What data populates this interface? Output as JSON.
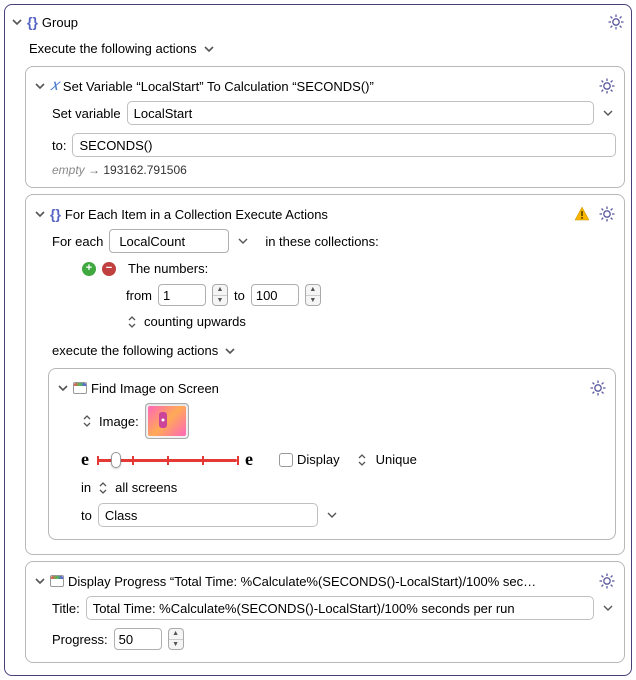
{
  "group": {
    "title": "Group",
    "subtitle": "Execute the following actions"
  },
  "setvar": {
    "title": "Set Variable “LocalStart” To Calculation “SECONDS()”",
    "label_set": "Set variable",
    "var_name": "LocalStart",
    "label_to": "to:",
    "expr": "SECONDS()",
    "empty_label": "empty",
    "arrow": "→",
    "result": "193162.791506"
  },
  "foreach": {
    "title": "For Each Item in a Collection Execute Actions",
    "label_for": "For each",
    "var_name": "LocalCount",
    "label_in": "in these collections:",
    "numbers_label": "The numbers:",
    "from_label": "from",
    "from_val": "1",
    "to_label": "to",
    "to_val": "100",
    "counting_label": "counting upwards",
    "exec_label": "execute the following actions"
  },
  "findimg": {
    "title": "Find Image on Screen",
    "image_label": "Image:",
    "display_label": "Display",
    "unique_label": "Unique",
    "e": "e",
    "in_label": "in",
    "screens_label": "all screens",
    "to_label": "to",
    "to_value": "Class"
  },
  "progress": {
    "title": "Display Progress “Total Time: %Calculate%(SECONDS()-LocalStart)/100% seco…",
    "title_label": "Title:",
    "title_value": "Total Time: %Calculate%(SECONDS()-LocalStart)/100% seconds per run",
    "progress_label": "Progress:",
    "progress_value": "50"
  }
}
